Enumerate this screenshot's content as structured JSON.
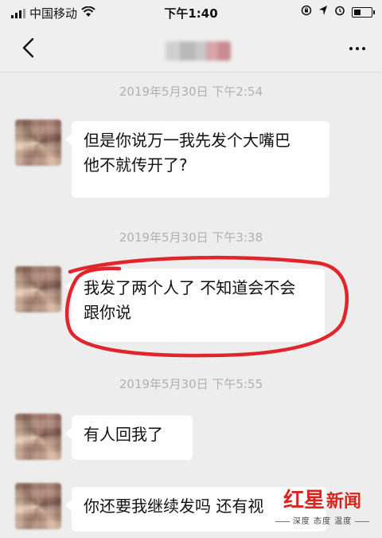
{
  "status_bar": {
    "carrier": "中国移动",
    "time": "下午1:40",
    "wifi_icon": "wifi-icon",
    "right_icons": [
      "screen-rotation-lock-icon",
      "location-arrow-icon",
      "alarm-icon",
      "battery-icon"
    ]
  },
  "nav": {
    "back_icon": "chevron-left-icon",
    "more_icon": "ellipsis-icon"
  },
  "messages": [
    {
      "timestamp": "2019年5月30日 下午2:54",
      "lines": [
        "但是你说万一我先发个大嘴巴",
        "他不就传开了?"
      ]
    },
    {
      "timestamp": "2019年5月30日 下午3:38",
      "lines": [
        "我发了两个人了 不知道会不会",
        "跟你说"
      ]
    },
    {
      "timestamp": "2019年5月30日 下午5:55",
      "lines": [
        "有人回我了"
      ]
    },
    {
      "lines": [
        "你还要我继续发吗 还有视"
      ]
    }
  ],
  "annotation": {
    "color": "#e0262c"
  },
  "watermark": {
    "brand": "红星",
    "news": "新闻",
    "slogan": "深度 态度 温度"
  }
}
